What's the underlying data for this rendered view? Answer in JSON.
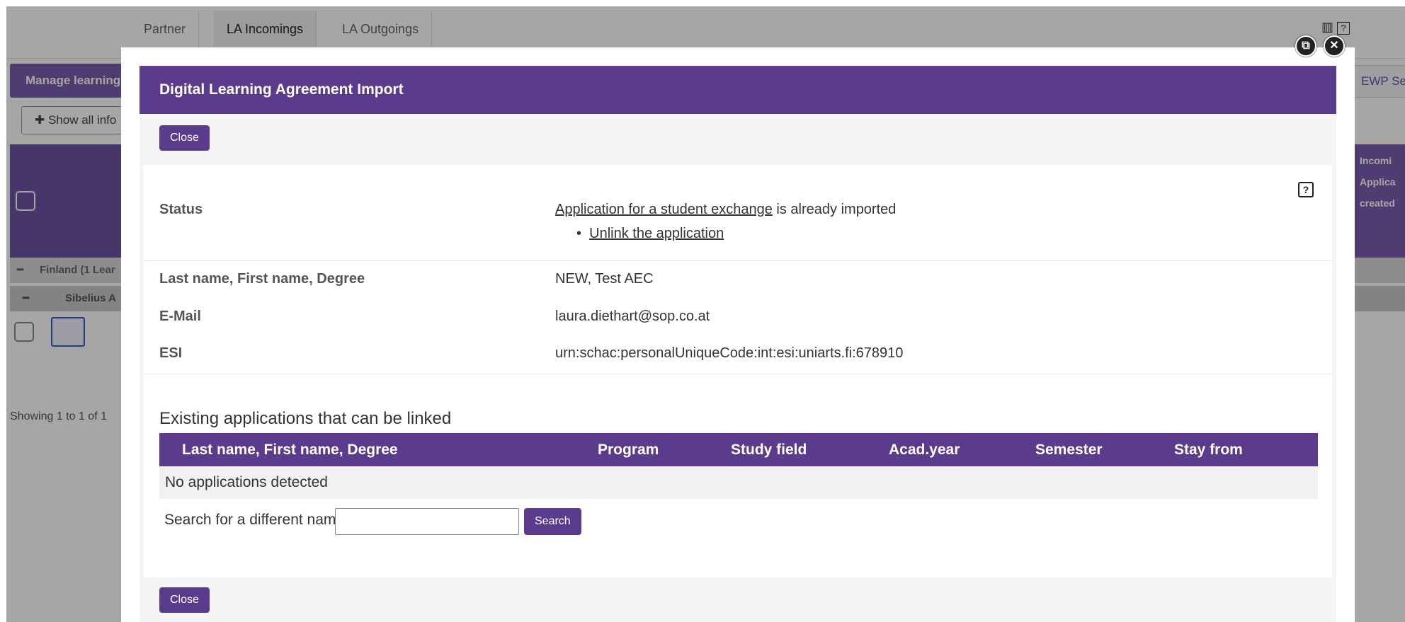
{
  "background": {
    "tabs": [
      {
        "label": "Partner"
      },
      {
        "label": "LA Incomings"
      },
      {
        "label": "LA Outgoings"
      }
    ],
    "manage_button": "Manage learning",
    "show_all_button": "Show all info",
    "group_country": "Finland (1 Lear",
    "group_institution": "Sibelius A",
    "showing_text": "Showing 1 to 1 of 1",
    "ewp_button": "EWP Se",
    "right_panel_text": [
      "Incomi",
      "Applica",
      "created"
    ]
  },
  "dialog": {
    "title": "Digital Learning Agreement Import",
    "close_label": "Close",
    "status": {
      "label": "Status",
      "link_text": "Application for a student exchange",
      "suffix": " is already imported",
      "unlink_text": "Unlink the application"
    },
    "student": {
      "name_label": "Last name, First name, Degree",
      "name_value": "NEW, Test AEC",
      "email_label": "E-Mail",
      "email_value": "laura.diethart@sop.co.at",
      "esi_label": "ESI",
      "esi_value": "urn:schac:personalUniqueCode:int:esi:uniarts.fi:678910"
    },
    "existing": {
      "title": "Existing applications that can be linked",
      "columns": [
        "Last name, First name, Degree",
        "Program",
        "Study field",
        "Acad.year",
        "Semester",
        "Stay from"
      ],
      "empty_text": "No applications detected",
      "search_label": "Search for a different name:",
      "search_value": "",
      "search_button": "Search"
    },
    "help_icon": "?"
  },
  "colors": {
    "header": "#5a3b8c",
    "button": "#5a3b8c"
  }
}
